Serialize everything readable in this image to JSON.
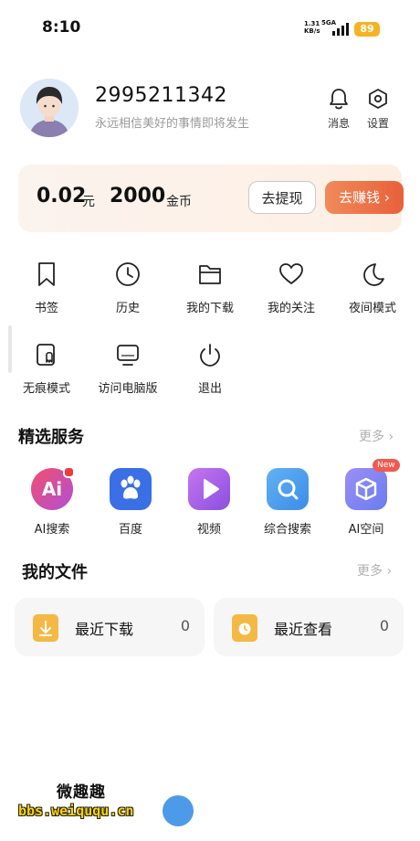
{
  "status_bar": {
    "time": "8:10",
    "net_speed_value": "1.31",
    "net_speed_unit": "KB/s",
    "network": "5GA",
    "battery": "89"
  },
  "profile": {
    "user_id": "2995211342",
    "motto": "永远相信美好的事情即将发生",
    "messages_label": "消息",
    "settings_label": "设置"
  },
  "wallet": {
    "cash_value": "0.02",
    "cash_unit": "元",
    "coins_value": "2000",
    "coins_unit": "金币",
    "withdraw_label": "去提现",
    "earn_label": "去赚钱",
    "earn_color": "#e8603a"
  },
  "quick_actions": [
    {
      "label": "书签",
      "icon": "bookmark-icon"
    },
    {
      "label": "历史",
      "icon": "clock-icon"
    },
    {
      "label": "我的下载",
      "icon": "folder-icon"
    },
    {
      "label": "我的关注",
      "icon": "heart-icon"
    },
    {
      "label": "夜间模式",
      "icon": "moon-icon"
    },
    {
      "label": "无痕模式",
      "icon": "ghost-icon"
    },
    {
      "label": "访问电脑版",
      "icon": "monitor-icon"
    },
    {
      "label": "退出",
      "icon": "power-icon"
    }
  ],
  "services": {
    "title": "精选服务",
    "more": "更多",
    "items": [
      {
        "label": "AI搜索",
        "icon": "ai-search-icon",
        "icon_text": "Ai"
      },
      {
        "label": "百度",
        "icon": "baidu-paw-icon"
      },
      {
        "label": "视频",
        "icon": "video-play-icon"
      },
      {
        "label": "综合搜索",
        "icon": "search-icon"
      },
      {
        "label": "AI空间",
        "icon": "ai-space-cube-icon",
        "badge": "New"
      }
    ]
  },
  "files": {
    "title": "我的文件",
    "more": "更多",
    "recent_downloads_label": "最近下载",
    "recent_downloads_count": "0",
    "recent_views_label": "最近查看",
    "recent_views_count": "0"
  },
  "watermark": {
    "title": "微趣趣",
    "url": "bbs.weiququ.cn"
  }
}
